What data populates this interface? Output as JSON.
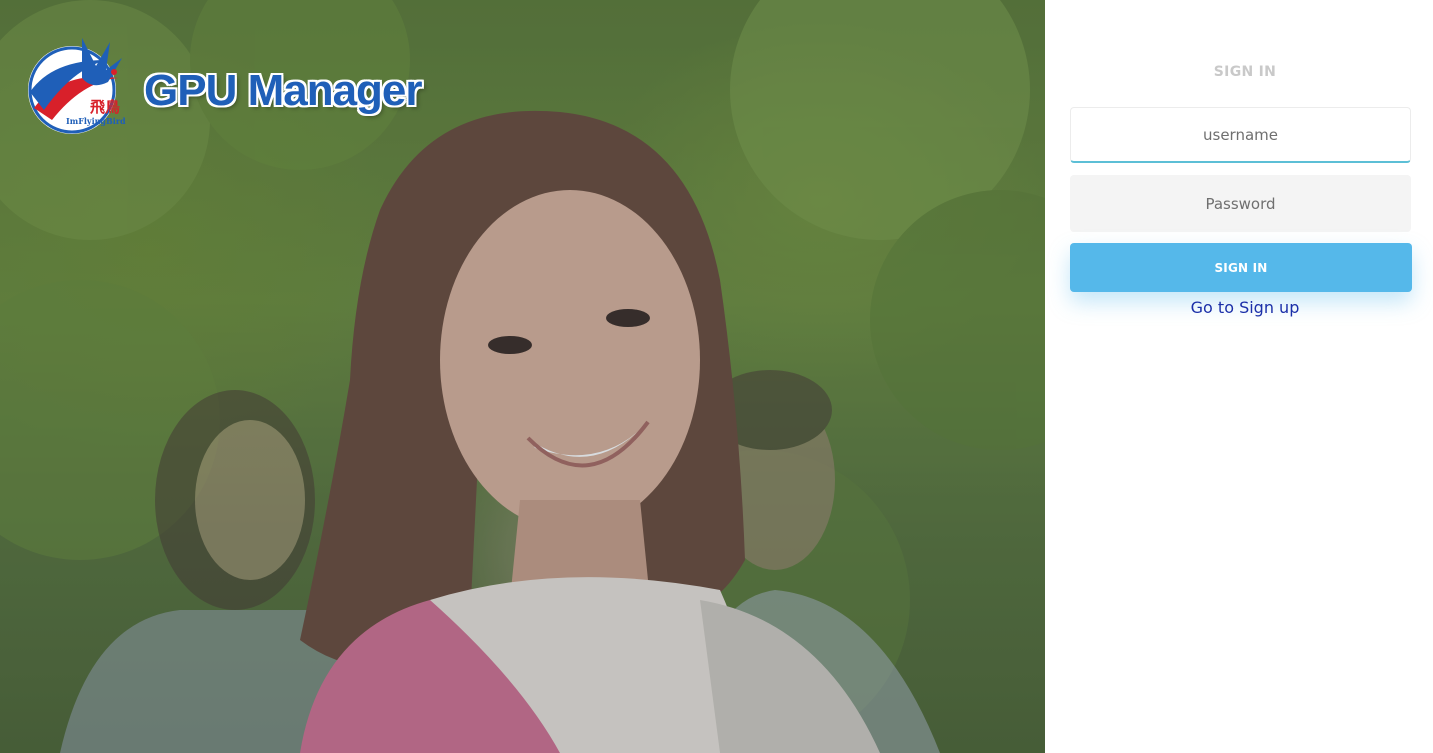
{
  "brand": {
    "title": "GPU Manager",
    "emblem_caption_cn": "飛鳥",
    "emblem_caption_en": "ImFlyingBird"
  },
  "signin": {
    "heading": "SIGN IN",
    "username_placeholder": "username",
    "password_placeholder": "Password",
    "submit_label": "SIGN IN",
    "signup_link": "Go to Sign up"
  },
  "colors": {
    "accent": "#55b8ea",
    "input_focus_border": "#5cbfd6",
    "link": "#1b2fa8",
    "brand_blue": "#1f5fb8",
    "heading_gray": "#c9c9c9"
  }
}
